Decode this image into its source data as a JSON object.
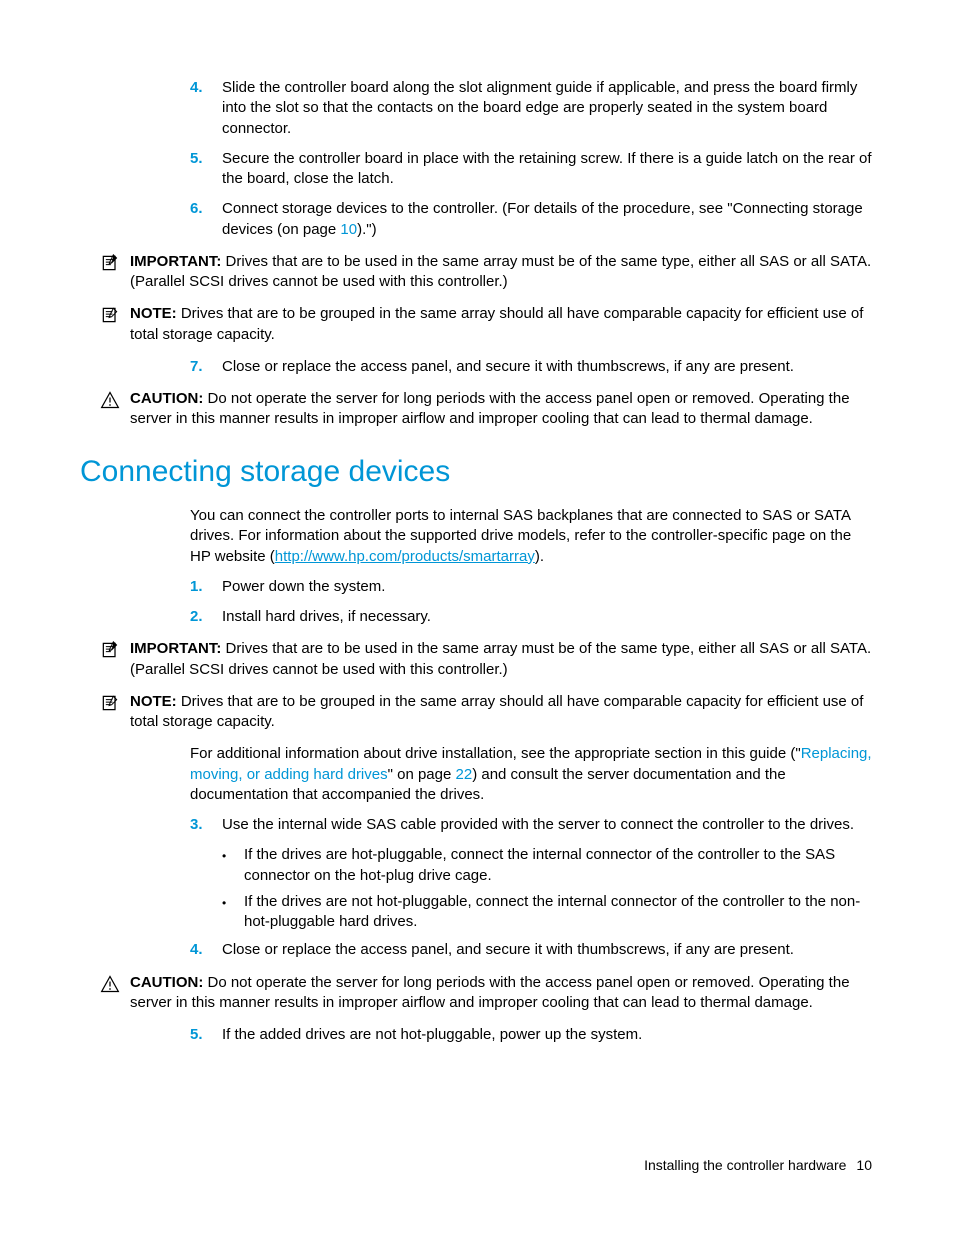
{
  "steps_top": [
    {
      "num": "4.",
      "text": "Slide the controller board along the slot alignment guide if applicable, and press the board firmly into the slot so that the contacts on the board edge are properly seated in the system board connector."
    },
    {
      "num": "5.",
      "text": "Secure the controller board in place with the retaining screw. If there is a guide latch on the rear of the board, close the latch."
    },
    {
      "num": "6.",
      "text_before": "Connect storage devices to the controller. (For details of the procedure, see \"Connecting storage devices (on page ",
      "page_ref": "10",
      "text_after": ").\")"
    }
  ],
  "callouts_top": [
    {
      "icon": "important",
      "label": "IMPORTANT:",
      "text": "  Drives that are to be used in the same array must be of the same type, either all SAS or all SATA. (Parallel SCSI drives cannot be used with this controller.)"
    },
    {
      "icon": "note",
      "label": "NOTE:",
      "text": "  Drives that are to be grouped in the same array should all have comparable capacity for efficient use of total storage capacity."
    }
  ],
  "step7": {
    "num": "7.",
    "text": "Close or replace the access panel, and secure it with thumbscrews, if any are present."
  },
  "caution1": {
    "label": "CAUTION:",
    "text": "  Do not operate the server for long periods with the access panel open or removed. Operating the server in this manner results in improper airflow and improper cooling that can lead to thermal damage."
  },
  "section_title": "Connecting storage devices",
  "intro": {
    "before_link": "You can connect the controller ports to internal SAS backplanes that are connected to SAS or SATA drives. For information about the supported drive models, refer to the controller-specific page on the HP website (",
    "link": "http://www.hp.com/products/smartarray",
    "after_link": ")."
  },
  "steps_b1": [
    {
      "num": "1.",
      "text": "Power down the system."
    },
    {
      "num": "2.",
      "text": "Install hard drives, if necessary."
    }
  ],
  "callouts_mid": [
    {
      "icon": "important",
      "label": "IMPORTANT:",
      "text": "  Drives that are to be used in the same array must be of the same type, either all SAS or all SATA. (Parallel SCSI drives cannot be used with this controller.)"
    },
    {
      "icon": "note",
      "label": "NOTE:",
      "text": "  Drives that are to be grouped in the same array should all have comparable capacity for efficient use of total storage capacity."
    }
  ],
  "add_info": {
    "before": "For additional information about drive installation, see the appropriate section in this guide (\"",
    "ref_text": "Replacing, moving, or adding hard drives",
    "mid": "\" on page ",
    "page": "22",
    "after": ") and consult the server documentation and the documentation that accompanied the drives."
  },
  "step3": {
    "num": "3.",
    "text": "Use the internal wide SAS cable provided with the server to connect the controller to the drives."
  },
  "bullets": [
    "If the drives are hot-pluggable, connect the internal connector of the controller to the SAS connector on the hot-plug drive cage.",
    "If the drives are not hot-pluggable, connect the internal connector of the controller to the non-hot-pluggable hard drives."
  ],
  "step4": {
    "num": "4.",
    "text": "Close or replace the access panel, and secure it with thumbscrews, if any are present."
  },
  "caution2": {
    "label": "CAUTION:",
    "text": "  Do not operate the server for long periods with the access panel open or removed. Operating the server in this manner results in improper airflow and improper cooling that can lead to thermal damage."
  },
  "step5": {
    "num": "5.",
    "text": "If the added drives are not hot-pluggable, power up the system."
  },
  "footer": {
    "label": "Installing the controller hardware",
    "page": "10"
  },
  "icons": {
    "bullet": "•"
  }
}
